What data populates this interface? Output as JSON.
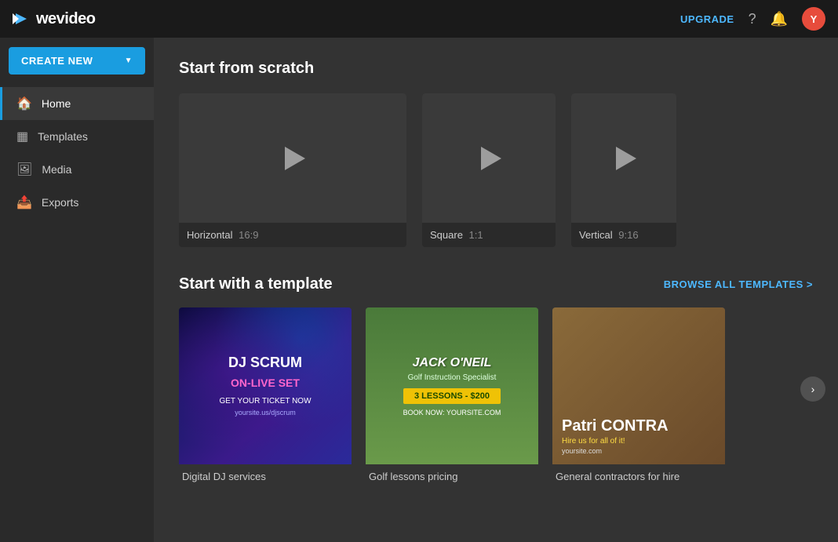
{
  "navbar": {
    "logo_text": "wevideo",
    "upgrade_label": "UPGRADE",
    "avatar_initial": "Y"
  },
  "sidebar": {
    "create_new_label": "CREATE NEW",
    "items": [
      {
        "id": "home",
        "label": "Home",
        "icon": "home"
      },
      {
        "id": "templates",
        "label": "Templates",
        "icon": "templates"
      },
      {
        "id": "media",
        "label": "Media",
        "icon": "media"
      },
      {
        "id": "exports",
        "label": "Exports",
        "icon": "exports"
      }
    ]
  },
  "main": {
    "scratch_section_title": "Start from scratch",
    "scratch_cards": [
      {
        "id": "horizontal",
        "format": "Horizontal",
        "ratio": "16:9"
      },
      {
        "id": "square",
        "format": "Square",
        "ratio": "1:1"
      },
      {
        "id": "vertical",
        "format": "Vertical",
        "ratio": "9:16"
      }
    ],
    "template_section_title": "Start with a template",
    "browse_all_label": "BROWSE ALL TEMPLATES >",
    "template_cards": [
      {
        "id": "dj",
        "title": "DJ SCRUM",
        "subtitle": "ON-LIVE SET",
        "cta": "GET YOUR TICKET NOW",
        "url": "yoursite.us/djscrum",
        "label": "Digital DJ services"
      },
      {
        "id": "golf",
        "name": "JACK O'NEIL",
        "subtitle": "Golf Instruction Specialist",
        "promo": "3 LESSONS - $200",
        "cta": "BOOK NOW: YOURSITE.COM",
        "label": "Golf lessons pricing"
      },
      {
        "id": "contractor",
        "name": "Patri CONTRA",
        "cta": "Hire us for all of it!",
        "url": "yoursite.com",
        "label": "General contractors for hire"
      }
    ]
  },
  "colors": {
    "accent": "#1a9de0",
    "link": "#4db8ff",
    "upgrade": "#4db8ff",
    "avatar_bg": "#e74c3c"
  }
}
